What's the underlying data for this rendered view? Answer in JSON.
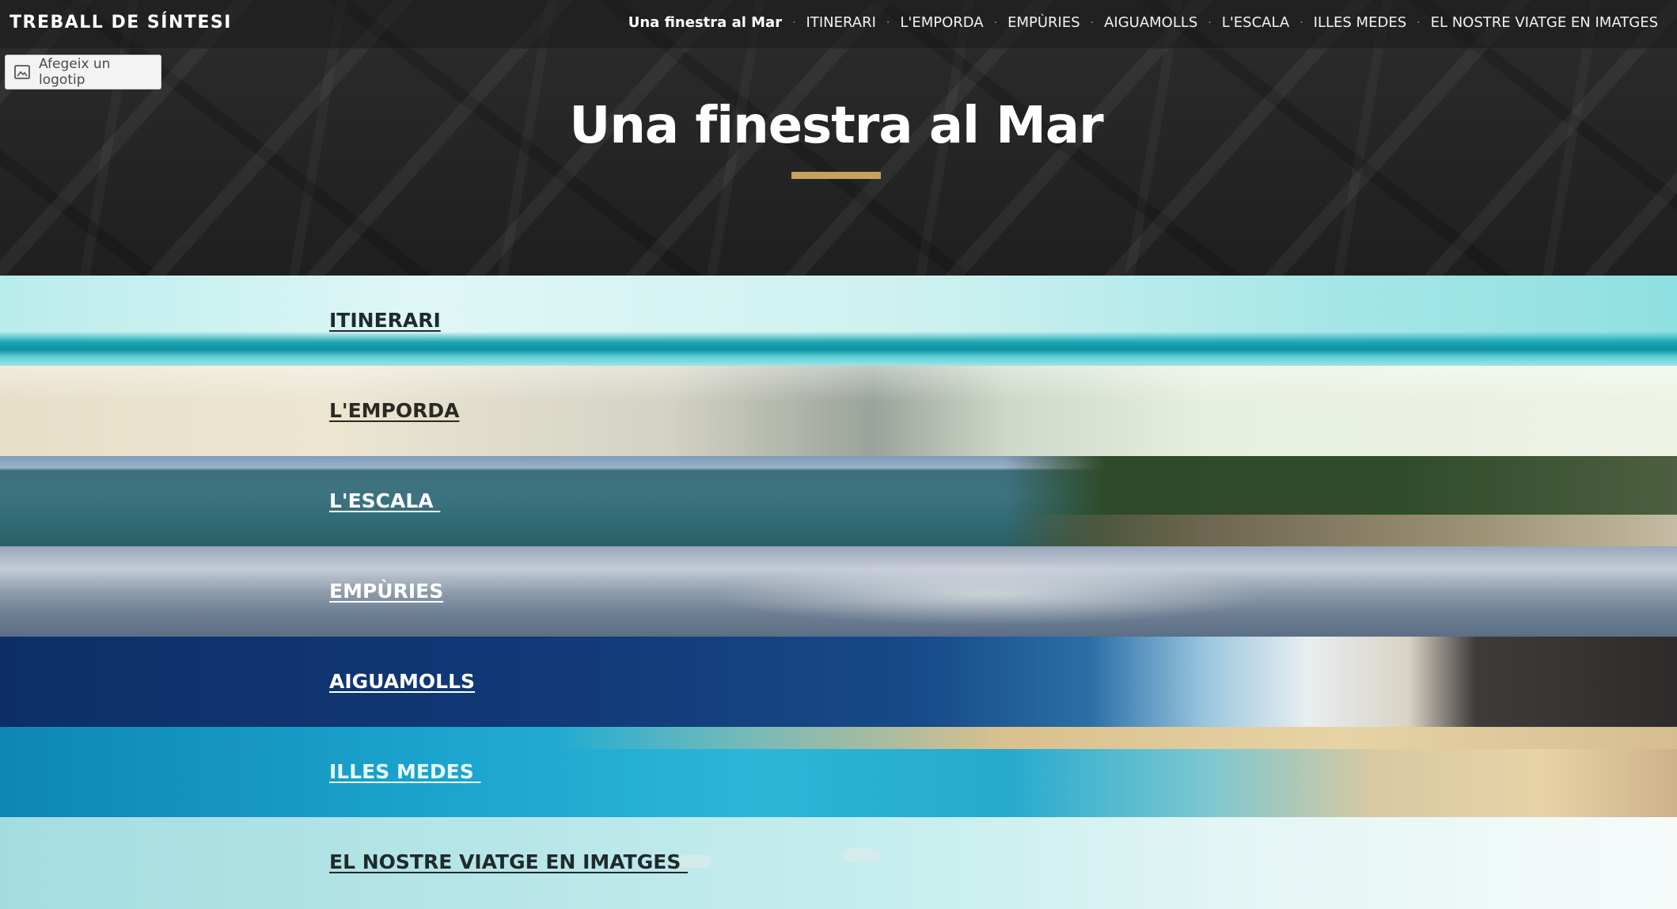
{
  "site": {
    "title": "TREBALL DE SÍNTESI"
  },
  "nav": {
    "items": [
      {
        "label": "Una finestra al Mar",
        "active": true
      },
      {
        "label": "ITINERARI"
      },
      {
        "label": "L'EMPORDA"
      },
      {
        "label": "EMPÙRIES"
      },
      {
        "label": "AIGUAMOLLS"
      },
      {
        "label": "L'ESCALA"
      },
      {
        "label": "ILLES MEDES"
      },
      {
        "label": "EL NOSTRE VIATGE EN IMATGES"
      }
    ],
    "separator": "·"
  },
  "logo_button": {
    "label": "Afegeix un logotip",
    "icon": "image-icon"
  },
  "hero": {
    "title": "Una finestra al Mar",
    "accent_color": "#c7a25c"
  },
  "sections": [
    {
      "label": "ITINERARI",
      "text_color": "#1f2a2c"
    },
    {
      "label": "L'EMPORDA",
      "text_color": "#2a2a22"
    },
    {
      "label": "L'ESCALA ",
      "text_color": "#ffffff"
    },
    {
      "label": "EMPÙRIES",
      "text_color": "#ffffff"
    },
    {
      "label": "AIGUAMOLLS",
      "text_color": "#ffffff"
    },
    {
      "label": "ILLES MEDES ",
      "text_color": "#e8fbff"
    },
    {
      "label": "EL NOSTRE VIATGE EN IMATGES ",
      "text_color": "#1f2a2c"
    }
  ]
}
